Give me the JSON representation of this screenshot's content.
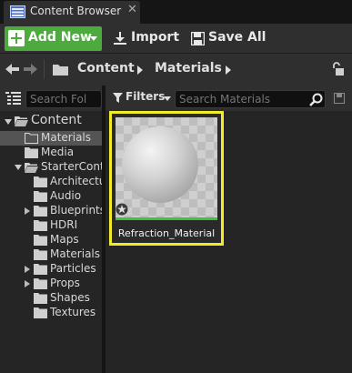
{
  "window": {
    "tab_title": "Content Browser",
    "tab_close_glyph": "✕",
    "tab_icon": "content-browser-icon"
  },
  "toolbar": {
    "add_new_label": "Add New",
    "import_label": "Import",
    "save_all_label": "Save All",
    "accent_color": "#4cab3c"
  },
  "path": {
    "crumbs": [
      "Content",
      "Materials"
    ]
  },
  "sources": {
    "search_placeholder": "Search Fol",
    "tree": [
      {
        "label": "Content",
        "expanded": true
      },
      {
        "label": "Materials",
        "selected": true
      },
      {
        "label": "Media"
      },
      {
        "label": "StarterCont",
        "expanded": true
      },
      {
        "label": "Architectu"
      },
      {
        "label": "Audio"
      },
      {
        "label": "Blueprints",
        "has_children": true
      },
      {
        "label": "HDRI"
      },
      {
        "label": "Maps"
      },
      {
        "label": "Materials"
      },
      {
        "label": "Particles",
        "has_children": true
      },
      {
        "label": "Props",
        "has_children": true
      },
      {
        "label": "Shapes"
      },
      {
        "label": "Textures"
      }
    ]
  },
  "assets": {
    "filters_label": "Filters",
    "search_placeholder": "Search Materials",
    "items": [
      {
        "name": "Refraction_Material",
        "selected": true,
        "highlight_color": "#f3ea2b",
        "type_bar_color": "#3ec33e"
      }
    ]
  }
}
